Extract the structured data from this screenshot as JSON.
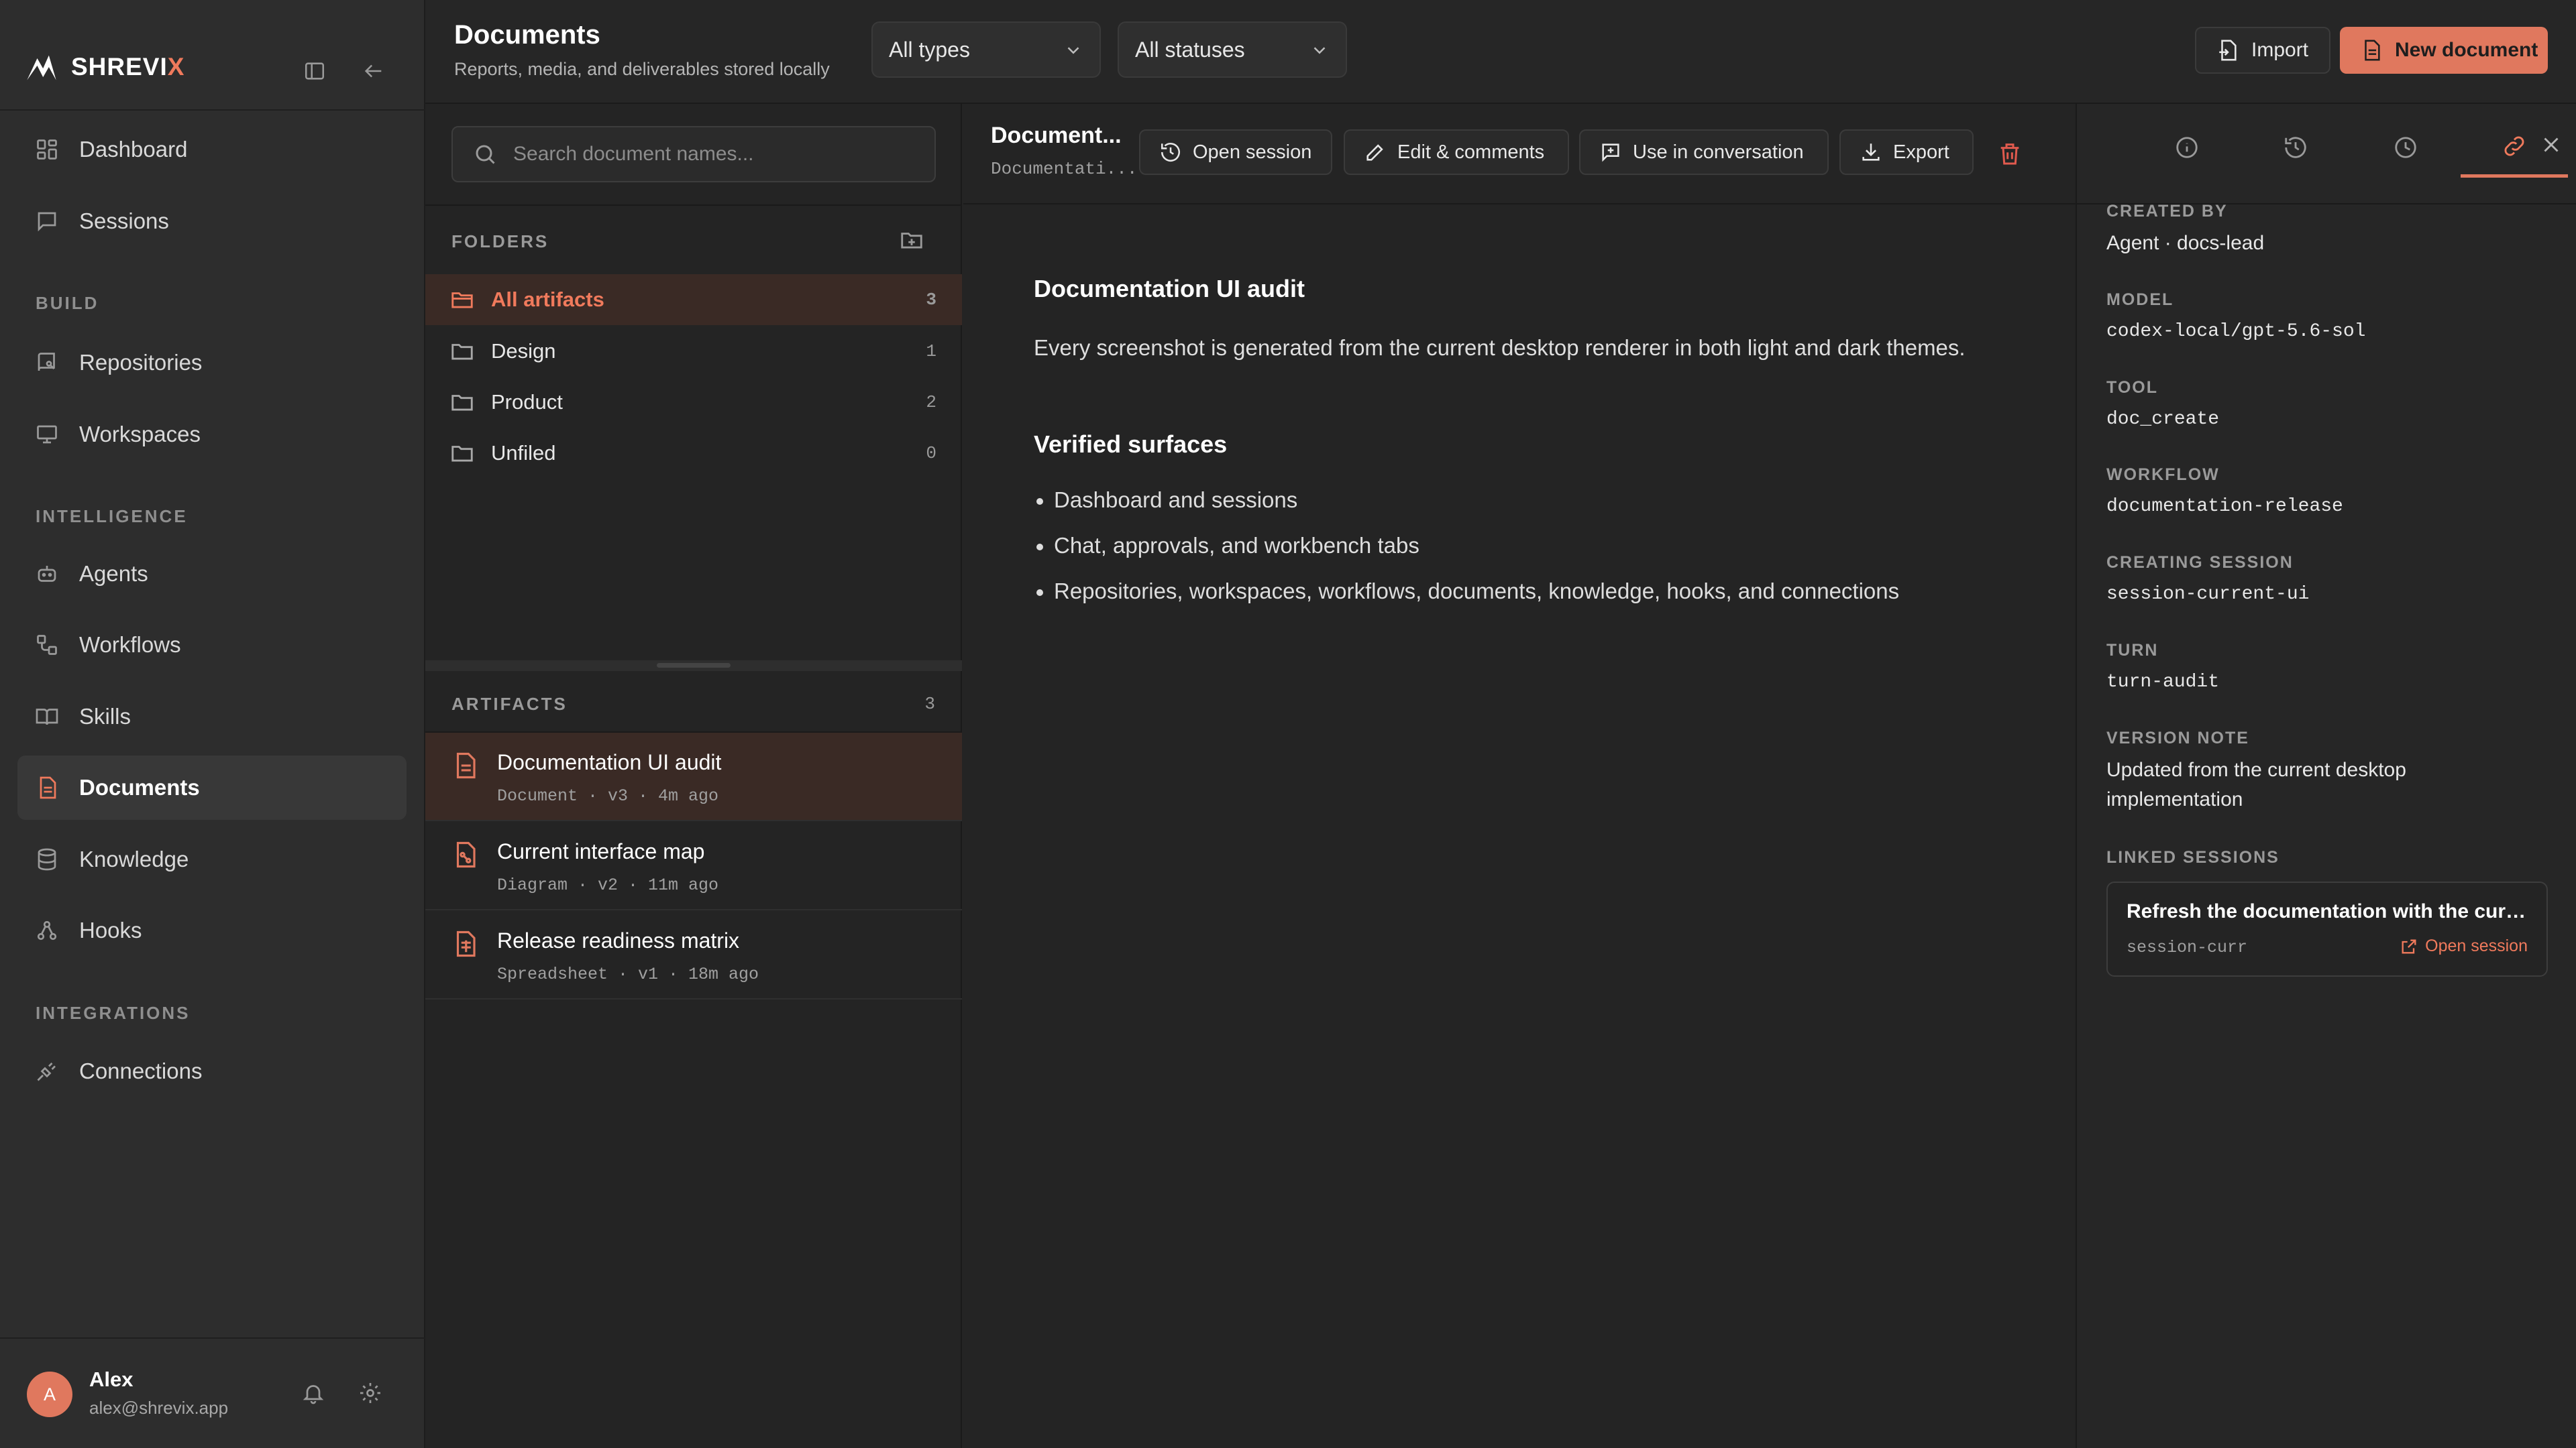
{
  "brand": {
    "name_main": "SHREVI",
    "name_accent": "X"
  },
  "sidebar": {
    "primary": [
      {
        "label": "Dashboard",
        "icon": "dashboard-icon"
      },
      {
        "label": "Sessions",
        "icon": "chat-icon"
      }
    ],
    "sections": [
      {
        "title": "BUILD",
        "items": [
          {
            "label": "Repositories",
            "icon": "repository-icon"
          },
          {
            "label": "Workspaces",
            "icon": "monitor-icon"
          }
        ]
      },
      {
        "title": "INTELLIGENCE",
        "items": [
          {
            "label": "Agents",
            "icon": "bot-icon"
          },
          {
            "label": "Workflows",
            "icon": "workflow-icon"
          },
          {
            "label": "Skills",
            "icon": "book-icon"
          },
          {
            "label": "Documents",
            "icon": "document-icon",
            "active": true
          },
          {
            "label": "Knowledge",
            "icon": "database-icon"
          },
          {
            "label": "Hooks",
            "icon": "webhook-icon"
          }
        ]
      },
      {
        "title": "INTEGRATIONS",
        "items": [
          {
            "label": "Connections",
            "icon": "plug-icon"
          }
        ]
      }
    ],
    "user": {
      "initial": "A",
      "name": "Alex",
      "email": "alex@shrevix.app"
    }
  },
  "header": {
    "title": "Documents",
    "subtitle": "Reports, media, and deliverables stored locally",
    "type_filter": "All types",
    "status_filter": "All statuses",
    "import_label": "Import",
    "new_label": "New document"
  },
  "list": {
    "search_placeholder": "Search document names...",
    "folders_title": "FOLDERS",
    "folders": [
      {
        "label": "All artifacts",
        "count": "3",
        "active": true
      },
      {
        "label": "Design",
        "count": "1"
      },
      {
        "label": "Product",
        "count": "2"
      },
      {
        "label": "Unfiled",
        "count": "0"
      }
    ],
    "artifacts_title": "ARTIFACTS",
    "artifacts_count": "3",
    "artifacts": [
      {
        "name": "Documentation UI audit",
        "meta": "Document · v3 · 4m ago",
        "active": true
      },
      {
        "name": "Current interface map",
        "meta": "Diagram · v2 · 11m ago"
      },
      {
        "name": "Release readiness matrix",
        "meta": "Spreadsheet · v1 · 18m ago"
      }
    ]
  },
  "document": {
    "toolbar_title": "Document...",
    "toolbar_sub": "Documentati...",
    "open_session": "Open session",
    "edit_comments": "Edit & comments",
    "use_in_conversation": "Use in conversation",
    "export": "Export",
    "heading": "Documentation UI audit",
    "paragraph": "Every screenshot is generated from the current desktop renderer in both light and dark themes.",
    "subheading": "Verified surfaces",
    "bullets": [
      "Dashboard and sessions",
      "Chat, approvals, and workbench tabs",
      "Repositories, workspaces, workflows, documents, knowledge, hooks, and connections"
    ]
  },
  "details": {
    "fields": [
      {
        "label": "CREATED BY",
        "value": "Agent · docs-lead",
        "mono": false
      },
      {
        "label": "MODEL",
        "value": "codex-local/gpt-5.6-sol",
        "mono": true
      },
      {
        "label": "TOOL",
        "value": "doc_create",
        "mono": true
      },
      {
        "label": "WORKFLOW",
        "value": "documentation-release",
        "mono": true
      },
      {
        "label": "CREATING SESSION",
        "value": "session-current-ui",
        "mono": true
      },
      {
        "label": "TURN",
        "value": "turn-audit",
        "mono": true
      },
      {
        "label": "VERSION NOTE",
        "value": "Updated from the current desktop implementation",
        "mono": false
      }
    ],
    "linked_title": "LINKED SESSIONS",
    "linked": {
      "title": "Refresh the documentation with the current UI",
      "session": "session-curr",
      "open_label": "Open session"
    }
  },
  "colors": {
    "accent": "#e0785e",
    "background": "#242424",
    "sidebar": "#2d2d2d",
    "danger": "#e05a4e"
  }
}
